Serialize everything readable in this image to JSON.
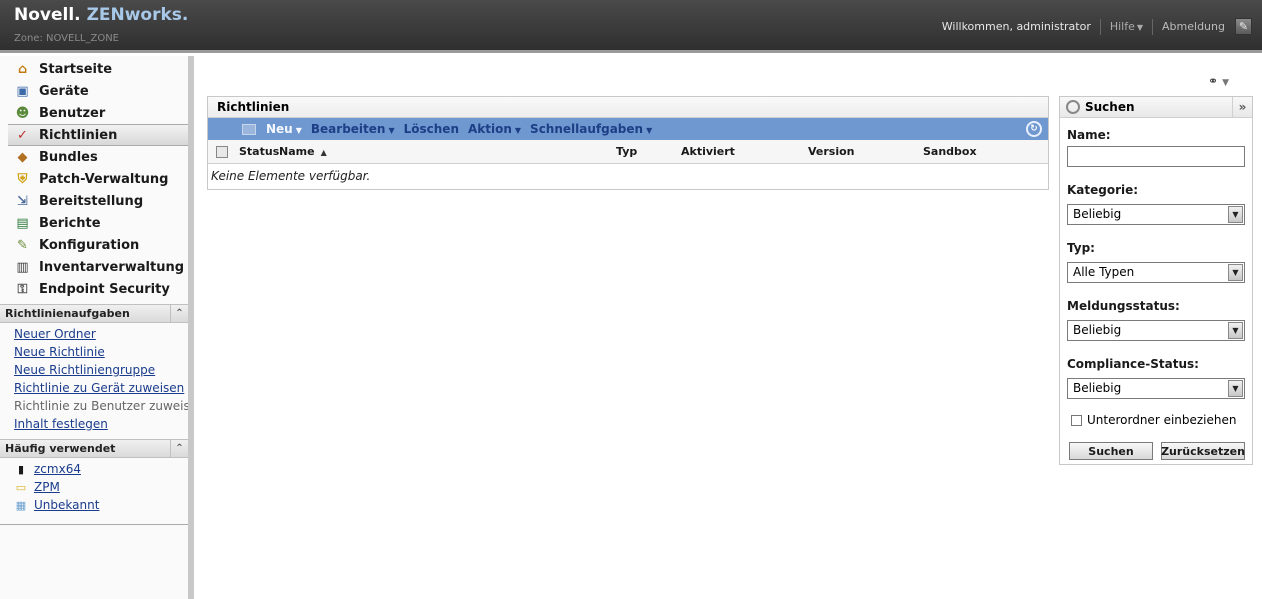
{
  "header": {
    "logo_novell": "Novell.",
    "logo_zen": "ZENworks.",
    "zone": "Zone: NOVELL_ZONE",
    "welcome": "Willkommen, administrator",
    "help": "Hilfe",
    "logout": "Abmeldung"
  },
  "nav": {
    "items": [
      {
        "label": "Startseite",
        "icon": "home-icon"
      },
      {
        "label": "Geräte",
        "icon": "monitor-icon"
      },
      {
        "label": "Benutzer",
        "icon": "users-icon"
      },
      {
        "label": "Richtlinien",
        "icon": "policy-icon"
      },
      {
        "label": "Bundles",
        "icon": "bundle-icon"
      },
      {
        "label": "Patch-Verwaltung",
        "icon": "shield-icon"
      },
      {
        "label": "Bereitstellung",
        "icon": "deploy-icon"
      },
      {
        "label": "Berichte",
        "icon": "report-icon"
      },
      {
        "label": "Konfiguration",
        "icon": "wrench-icon"
      },
      {
        "label": "Inventarverwaltung",
        "icon": "inventory-icon"
      },
      {
        "label": "Endpoint Security",
        "icon": "lock-icon"
      }
    ],
    "active_index": 3
  },
  "tasks": {
    "title": "Richtlinienaufgaben",
    "items": [
      {
        "label": "Neuer Ordner",
        "enabled": true
      },
      {
        "label": "Neue Richtlinie",
        "enabled": true
      },
      {
        "label": "Neue Richtliniengruppe",
        "enabled": true
      },
      {
        "label": "Richtlinie zu Gerät zuweisen",
        "enabled": true
      },
      {
        "label": "Richtlinie zu Benutzer zuweisen",
        "enabled": false
      },
      {
        "label": "Inhalt festlegen",
        "enabled": true
      }
    ]
  },
  "frequent": {
    "title": "Häufig verwendet",
    "items": [
      {
        "label": "zcmx64",
        "icon": "device-icon"
      },
      {
        "label": "ZPM",
        "icon": "folder-icon"
      },
      {
        "label": "Unbekannt",
        "icon": "unknown-icon"
      }
    ]
  },
  "main": {
    "title": "Richtlinien",
    "toolbar": {
      "new": "Neu",
      "edit": "Bearbeiten",
      "delete": "Löschen",
      "action": "Aktion",
      "quick": "Schnellaufgaben"
    },
    "columns": {
      "status": "Status",
      "name": "Name",
      "type": "Typ",
      "enabled": "Aktiviert",
      "version": "Version",
      "sandbox": "Sandbox"
    },
    "empty": "Keine Elemente verfügbar."
  },
  "search": {
    "title": "Suchen",
    "name_label": "Name:",
    "name_value": "",
    "category_label": "Kategorie:",
    "category_value": "Beliebig",
    "type_label": "Typ:",
    "type_value": "Alle Typen",
    "msg_label": "Meldungsstatus:",
    "msg_value": "Beliebig",
    "compliance_label": "Compliance-Status:",
    "compliance_value": "Beliebig",
    "subfolders": "Unterordner einbeziehen",
    "search_btn": "Suchen",
    "reset_btn": "Zurücksetzen"
  }
}
